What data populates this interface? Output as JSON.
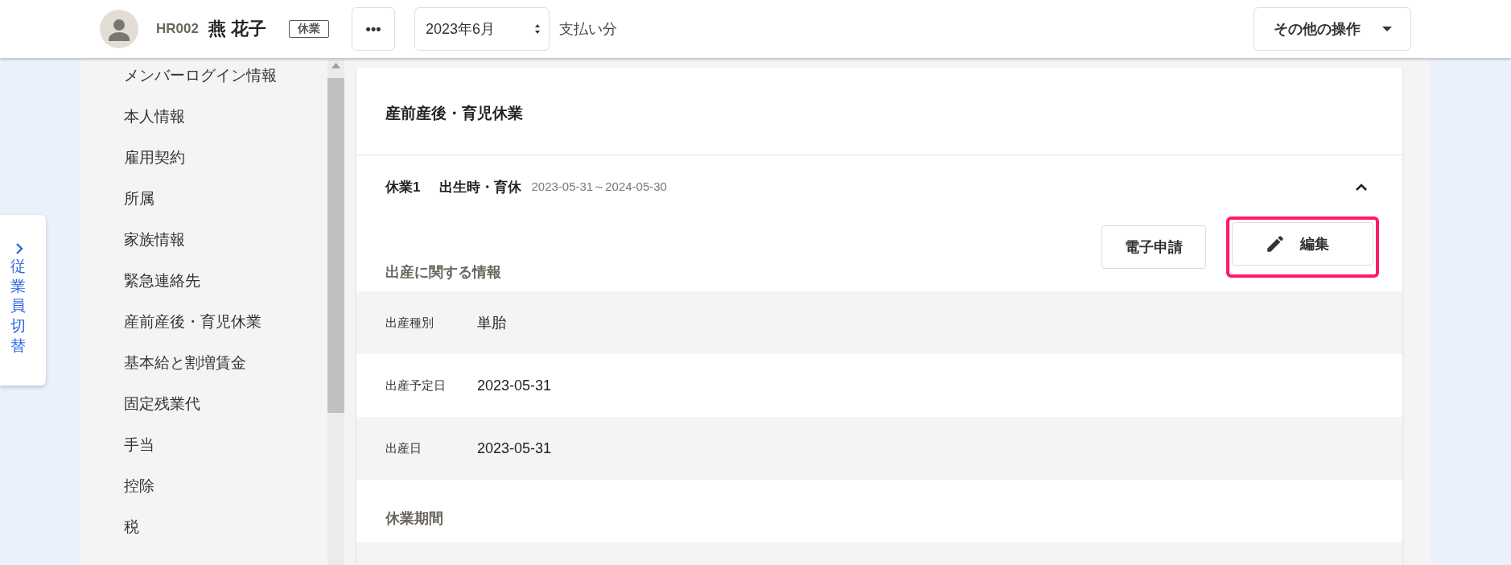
{
  "header": {
    "employee_id": "HR002",
    "name": "燕 花子",
    "status_badge": "休業",
    "more_button": "•••",
    "month_select": "2023年6月",
    "payment_label": "支払い分",
    "actions_button": "その他の操作"
  },
  "switcher": {
    "label": "従業員切替"
  },
  "sidebar": {
    "items": [
      {
        "label": "メンバーログイン情報"
      },
      {
        "label": "本人情報"
      },
      {
        "label": "雇用契約"
      },
      {
        "label": "所属"
      },
      {
        "label": "家族情報"
      },
      {
        "label": "緊急連絡先"
      },
      {
        "label": "産前産後・育児休業"
      },
      {
        "label": "基本給と割増賃金"
      },
      {
        "label": "固定残業代"
      },
      {
        "label": "手当"
      },
      {
        "label": "控除"
      },
      {
        "label": "税"
      }
    ]
  },
  "card": {
    "title": "産前産後・育児休業",
    "leave": {
      "title": "休業1",
      "type": "出生時・育休",
      "period": "2023-05-31～2024-05-30",
      "expanded": true
    },
    "buttons": [
      {
        "label": "電子申請",
        "kind": "plain",
        "highlighted": false
      },
      {
        "label": "編集",
        "kind": "edit",
        "highlighted": true
      }
    ],
    "sections": [
      {
        "heading": "出産に関する情報",
        "rows": [
          {
            "label": "出産種別",
            "value": "単胎"
          },
          {
            "label": "出産予定日",
            "value": "2023-05-31"
          },
          {
            "label": "出産日",
            "value": "2023-05-31"
          }
        ]
      },
      {
        "heading": "休業期間"
      }
    ]
  }
}
